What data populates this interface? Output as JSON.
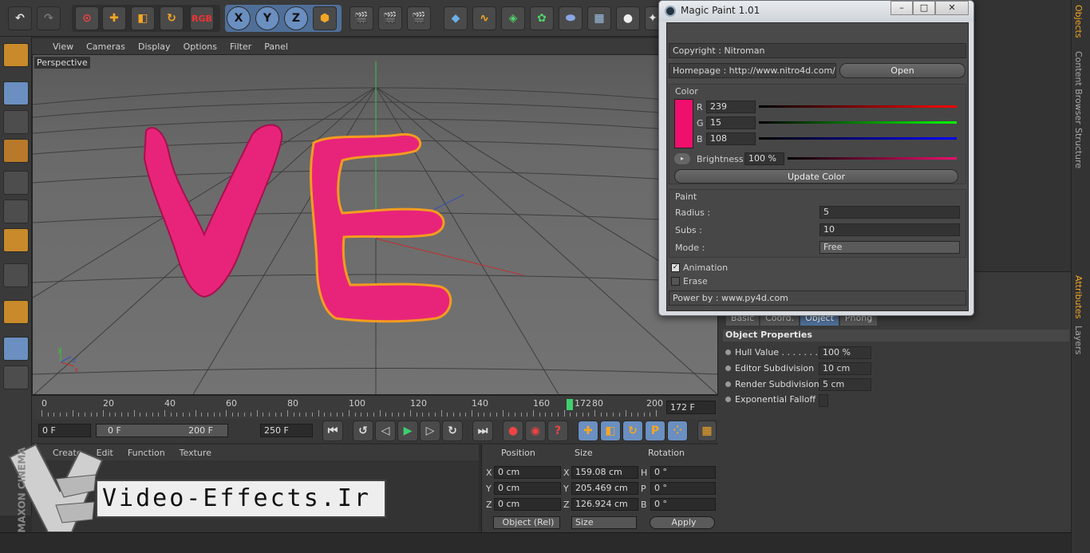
{
  "toolbar": {
    "axis_x": "X",
    "axis_y": "Y",
    "axis_z": "Z",
    "rgb_label": "RGB"
  },
  "viewport": {
    "menu": [
      "View",
      "Cameras",
      "Display",
      "Options",
      "Filter",
      "Panel"
    ],
    "label": "Perspective"
  },
  "timeline": {
    "ticks": [
      "0",
      "20",
      "40",
      "60",
      "80",
      "100",
      "120",
      "140",
      "160",
      "172",
      "80",
      "200"
    ],
    "current_frame": "172 F",
    "playhead_fraction": 0.86
  },
  "controls": {
    "start_frame": "0 F",
    "range_start": "0 F",
    "range_end": "200 F",
    "end_frame": "250 F"
  },
  "bottom_menu": [
    "Create",
    "Edit",
    "Function",
    "Texture"
  ],
  "coords": {
    "headers": [
      "Position",
      "Size",
      "Rotation"
    ],
    "rows": [
      {
        "axis": "X",
        "pos": "0 cm",
        "size_axis": "X",
        "size": "159.08 cm",
        "rot_axis": "H",
        "rot": "0 °"
      },
      {
        "axis": "Y",
        "pos": "0 cm",
        "size_axis": "Y",
        "size": "205.469 cm",
        "rot_axis": "P",
        "rot": "0 °"
      },
      {
        "axis": "Z",
        "pos": "0 cm",
        "size_axis": "Z",
        "size": "126.924 cm",
        "rot_axis": "B",
        "rot": "0 °"
      }
    ],
    "mode": "Object (Rel)",
    "size_mode": "Size",
    "apply": "Apply"
  },
  "dialog": {
    "title": "Magic Paint 1.01",
    "copyright": "Copyright : Nitroman",
    "homepage": "Homepage : http://www.nitro4d.com/",
    "open": "Open",
    "color_group": "Color",
    "r_label": "R",
    "r_value": "239",
    "g_label": "G",
    "g_value": "15",
    "b_label": "B",
    "b_value": "108",
    "brightness_label": "Brightness",
    "brightness_value": "100 %",
    "update_color": "Update Color",
    "paint_group": "Paint",
    "radius_label": "Radius :",
    "radius_value": "5",
    "subs_label": "Subs :",
    "subs_value": "10",
    "mode_label": "Mode :",
    "mode_value": "Free",
    "animation": "Animation",
    "erase": "Erase",
    "power": "Power by : www.py4d.com",
    "swatch_color": "#ef0f6c"
  },
  "attributes": {
    "tabs": [
      "Basic",
      "Coord.",
      "Object",
      "Phong"
    ],
    "section": "Object Properties",
    "rows": [
      {
        "label": "Hull Value . . . . . . .",
        "value": "100 %"
      },
      {
        "label": "Editor Subdivision",
        "value": "10 cm"
      },
      {
        "label": "Render Subdivision",
        "value": "5 cm"
      },
      {
        "label": "Exponential Falloff",
        "value": ""
      }
    ]
  },
  "side_tabs": [
    "Objects",
    "Content Browser",
    "Structure",
    "Attributes",
    "Layers"
  ],
  "watermark": "Video-Effects.Ir",
  "logo_text": "MAXON CINEMA"
}
